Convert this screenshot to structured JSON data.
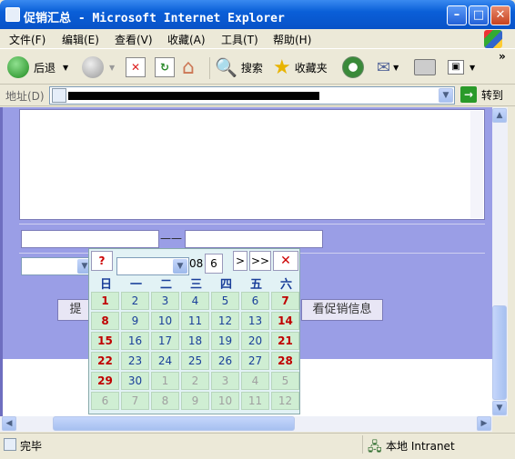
{
  "window": {
    "title": "促销汇总 - Microsoft Internet Explorer"
  },
  "menu": [
    "文件(F)",
    "编辑(E)",
    "查看(V)",
    "收藏(A)",
    "工具(T)",
    "帮助(H)"
  ],
  "toolbar": {
    "back": "后退",
    "search": "搜索",
    "favorites": "收藏夹"
  },
  "address": {
    "label": "地址(D)",
    "go": "转到"
  },
  "page": {
    "dash": "——",
    "submit_button": "提",
    "view_button": "看促销信息"
  },
  "calendar": {
    "help": "?",
    "prev_month": "<",
    "month_value": "6",
    "year_partial": "08",
    "next": ">",
    "next_year": ">>",
    "close": "✕",
    "weekdays": [
      "日",
      "一",
      "二",
      "三",
      "四",
      "五",
      "六"
    ],
    "weeks": [
      [
        "1",
        "2",
        "3",
        "4",
        "5",
        "6",
        "7"
      ],
      [
        "8",
        "9",
        "10",
        "11",
        "12",
        "13",
        "14"
      ],
      [
        "15",
        "16",
        "17",
        "18",
        "19",
        "20",
        "21"
      ],
      [
        "22",
        "23",
        "24",
        "25",
        "26",
        "27",
        "28"
      ],
      [
        "29",
        "30",
        "1",
        "2",
        "3",
        "4",
        "5"
      ],
      [
        "6",
        "7",
        "8",
        "9",
        "10",
        "11",
        "12"
      ]
    ]
  },
  "status": {
    "text": "完毕",
    "zone": "本地 Intranet"
  },
  "colors": {
    "titlebar": "#0a5fd8",
    "form_bg": "#9a9ee6",
    "calendar_weekend": "#c00000",
    "calendar_weekday": "#1a3f9a"
  }
}
